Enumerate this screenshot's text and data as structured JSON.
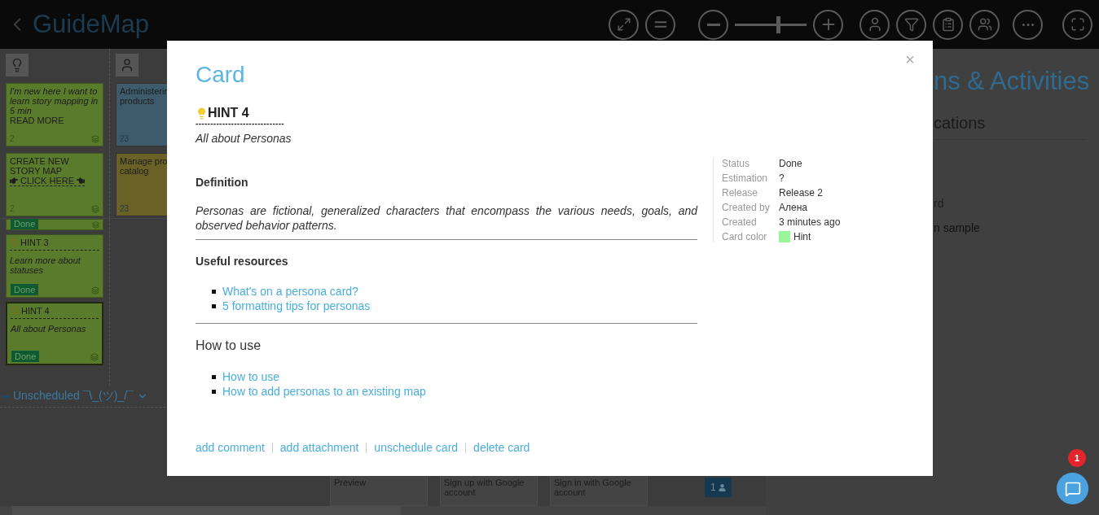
{
  "header": {
    "title": "GuideMap",
    "zoom": {
      "level": 0.6
    }
  },
  "activity_column_1": [
    {
      "kind": "intro",
      "color": "#5a7a2c",
      "italic": "I'm new here I want to learn story mapping in 5 min",
      "text": "READ MORE",
      "count": "2"
    },
    {
      "kind": "cta",
      "color": "#5a7a2c",
      "text": "CREATE NEW STORY MAP",
      "link": "CLICK HERE",
      "count": "2"
    }
  ],
  "activity_column_2": [
    {
      "kind": "plain",
      "color": "#3e5b6b",
      "text": "Administerin",
      "text_2": "products",
      "count": "23"
    },
    {
      "kind": "plain",
      "color": "#6a6126",
      "text": "Manage pro",
      "text_2": "catalog",
      "count": "23"
    }
  ],
  "release_cards": [
    {
      "kind": "partial",
      "color": "#5a7a2c",
      "status": "Done",
      "selected": false
    },
    {
      "kind": "hint",
      "color": "#5a7a2c",
      "title": "HINT 3",
      "italic": "Learn more about statuses",
      "status": "Done",
      "selected": false
    },
    {
      "kind": "hint",
      "color": "#5a7a2c",
      "title": "HINT 4",
      "italic": "All about Personas",
      "status": "Done",
      "selected": true
    }
  ],
  "unscheduled": {
    "label": "Unscheduled ¯\\_(ツ)_/¯",
    "expanded": false
  },
  "bottom_cards": [
    "Preview",
    "Sign up with Google account",
    "Sign in with Google account"
  ],
  "member_badge": "1",
  "right_panel": {
    "title": "ns & Activities",
    "tab": "cations",
    "items": [
      "rd",
      "n sample"
    ]
  },
  "modal": {
    "title": "Card",
    "close": "×",
    "hint_title": "HINT 4",
    "rule": "------------------------------",
    "subtitle": "All about Personas",
    "sections": [
      {
        "kind": "text",
        "heading": "Definition",
        "body": "Personas are fictional, generalized characters that encompass the various needs, goals, and observed behavior patterns."
      },
      {
        "kind": "links",
        "heading": "Useful resources",
        "links": [
          "What's on a persona card?",
          "5 formatting tips for personas"
        ]
      },
      {
        "kind": "links_light",
        "heading": "How to use",
        "links": [
          "How to use",
          "How to add personas to an existing map"
        ]
      }
    ],
    "meta": [
      {
        "label": "Status",
        "value": "Done"
      },
      {
        "label": "Estimation",
        "value": "?"
      },
      {
        "label": "Release",
        "value": "Release 2"
      },
      {
        "label": "Created by",
        "value": "Алена"
      },
      {
        "label": "Created",
        "value": "3 minutes ago"
      },
      {
        "label": "Card color",
        "value": "Hint",
        "color": "#98f598"
      }
    ],
    "actions": [
      "add comment",
      "add attachment",
      "unschedule card",
      "delete card"
    ]
  },
  "chat": {
    "badge": "1"
  }
}
